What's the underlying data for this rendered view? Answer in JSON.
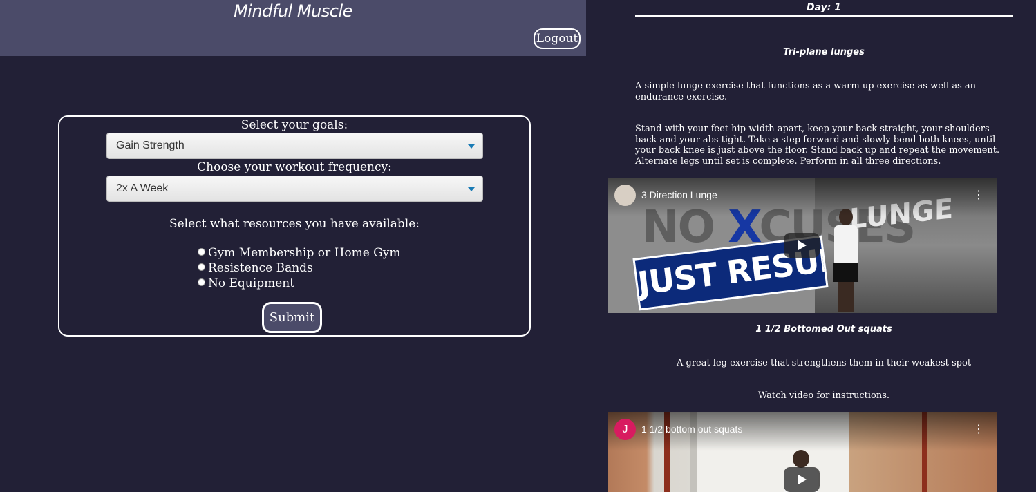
{
  "app": {
    "title": "Mindful Muscle",
    "logout_label": "Logout"
  },
  "form": {
    "goals_label": "Select your goals:",
    "goals_value": "Gain Strength",
    "frequency_label": "Choose your workout frequency:",
    "frequency_value": "2x A Week",
    "resources_label": "Select what resources you have available:",
    "resources": [
      {
        "label": "Gym Membership or Home Gym",
        "checked": false
      },
      {
        "label": "Resistence Bands",
        "checked": false
      },
      {
        "label": "No Equipment",
        "checked": false
      }
    ],
    "submit_label": "Submit"
  },
  "workout": {
    "day_label": "Day: 1",
    "exercises": [
      {
        "name": "Tri-plane lunges",
        "description": "A simple lunge exercise that functions as a warm up exercise as well as an endurance exercise.",
        "instructions": "Stand with your feet hip-width apart, keep your back straight, your shoulders back and your abs tight. Take a step forward and slowly bend both knees, until your back knee is just above the floor. Stand back up and repeat the movement. Alternate legs until set is complete. Perform in all three directions.",
        "video": {
          "title": "3 Direction Lunge",
          "thumb_left": "NO",
          "thumb_x": "X",
          "thumb_right": "CUSES",
          "thumb_banner": "JUST RESULTS",
          "thumb_side": "LUNGE"
        }
      },
      {
        "name": "1 1/2 Bottomed Out squats",
        "description": "A great leg exercise that strengthens them in their weakest spot",
        "instructions": "Watch video for instructions.",
        "video": {
          "title": "1 1/2 bottom out squats",
          "channel_initial": "J"
        }
      }
    ]
  },
  "theme": {
    "background": "#222036",
    "header": "#4b4b69",
    "accent": "#1a7bb5"
  },
  "icons": {
    "select_caret": "chevron-down-icon",
    "video_play": "play-icon",
    "video_menu": "more-vert-icon"
  }
}
